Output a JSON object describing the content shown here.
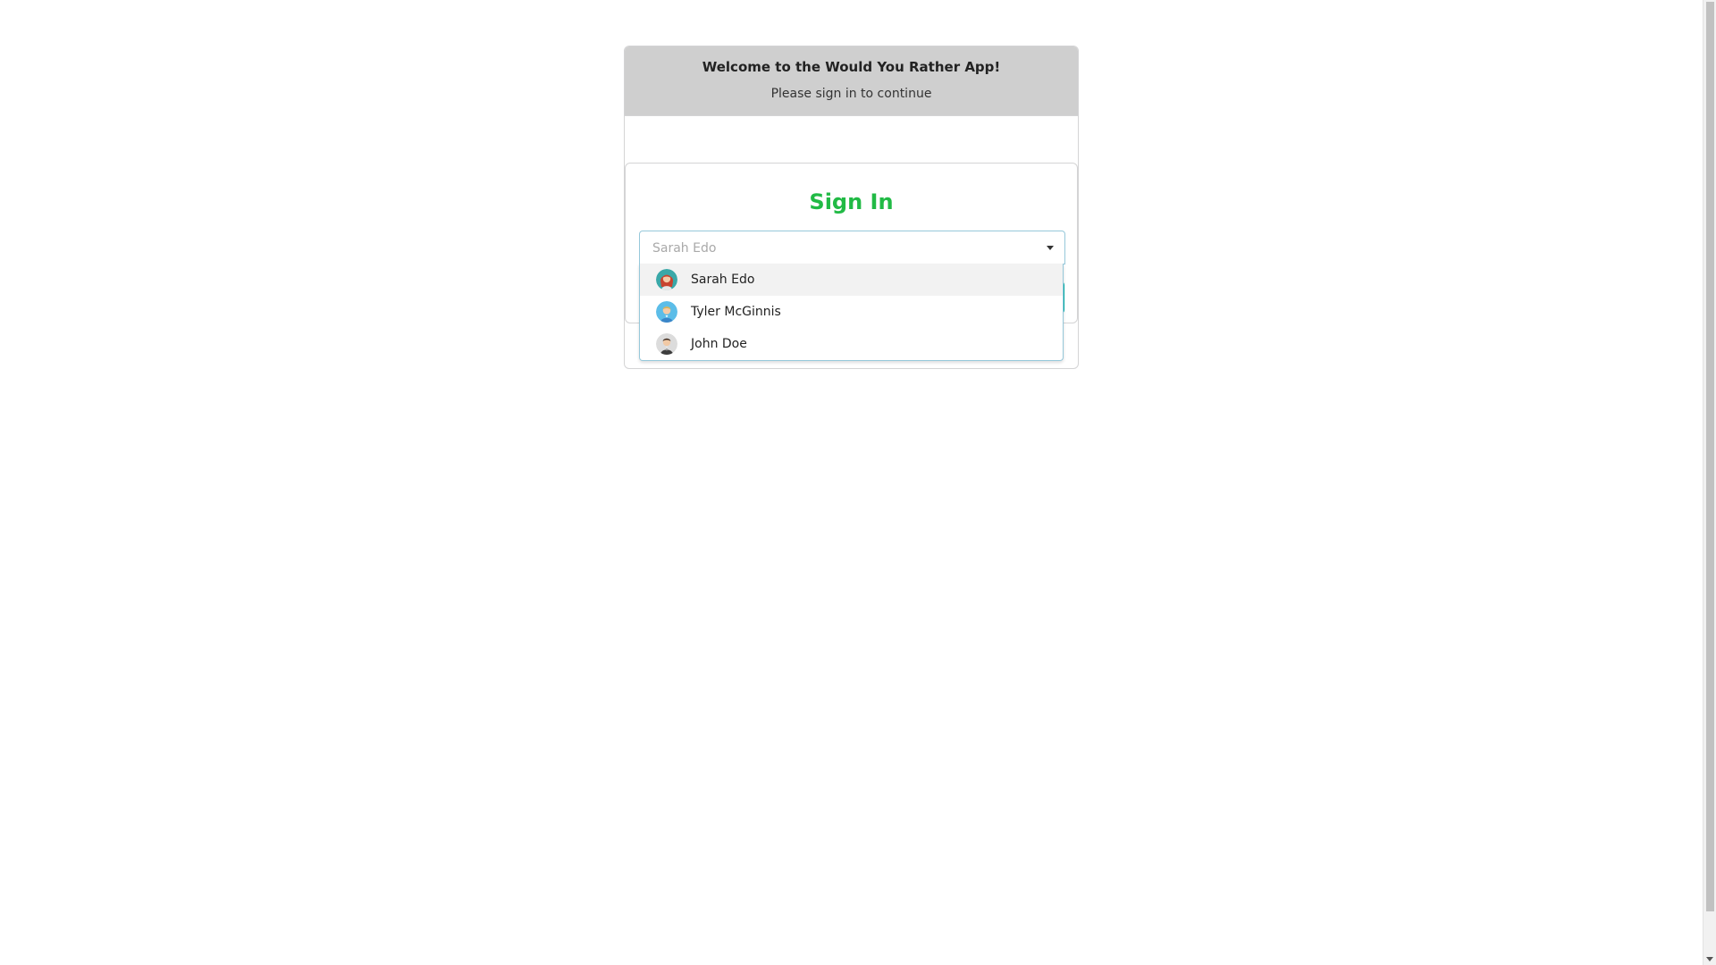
{
  "header": {
    "title": "Welcome to the Would You Rather App!",
    "subtitle": "Please sign in to continue"
  },
  "signin": {
    "title": "Sign In",
    "title_color": "#21ba45"
  },
  "dropdown": {
    "selected_text": "Sarah Edo",
    "options": [
      {
        "label": "Sarah Edo",
        "avatar_icon": "woman-red-hair-avatar-icon"
      },
      {
        "label": "Tyler McGinnis",
        "avatar_icon": "man-blond-avatar-icon"
      },
      {
        "label": "John Doe",
        "avatar_icon": "man-suit-avatar-icon"
      }
    ]
  }
}
